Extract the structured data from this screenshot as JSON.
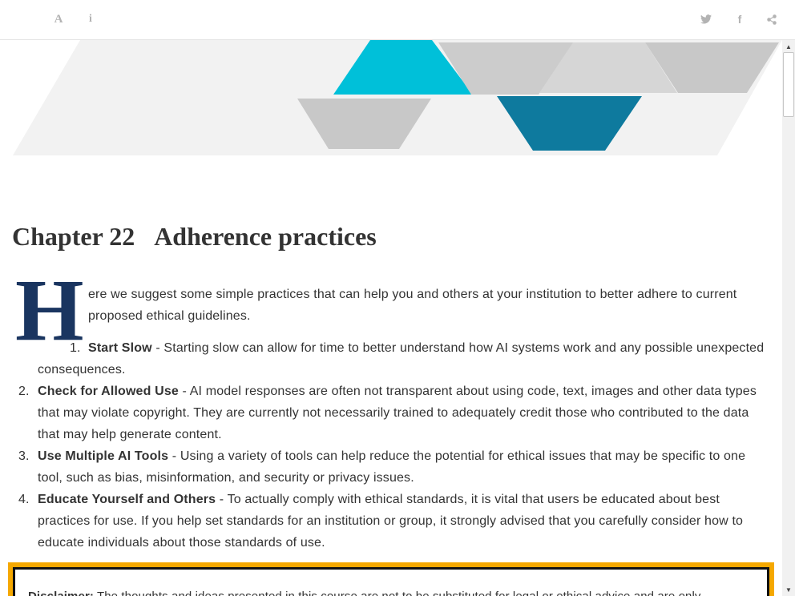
{
  "toolbar": {
    "font_icon_glyph": "A",
    "info_icon_glyph": "i",
    "twitter_icon_glyph": "",
    "facebook_icon_glyph": "f",
    "icon_color": "#b3b3b3"
  },
  "chapter": {
    "number": "Chapter 22",
    "title": "Adherence practices"
  },
  "intro": {
    "dropcap": "H",
    "text": "ere we suggest some simple practices that can help you and others at your institution to better adhere to current proposed ethical guidelines."
  },
  "practices": [
    {
      "num": "1.",
      "title": "Start Slow",
      "text": " - Starting slow can allow for time to better understand how AI systems work and any possible unexpected consequences."
    },
    {
      "num": "2.",
      "title": "Check for Allowed Use",
      "text": " - AI model responses are often not transparent about using code, text, images and other data types that may violate copyright. They are currently not necessarily trained to adequately credit those who contributed to the data that may help generate content."
    },
    {
      "num": "3.",
      "title": "Use Multiple AI Tools",
      "text": " - Using a variety of tools can help reduce the potential for ethical issues that may be specific to one tool, such as bias, misinformation, and security or privacy issues."
    },
    {
      "num": "4.",
      "title": "Educate Yourself and Others",
      "text": " - To actually comply with ethical standards, it is vital that users be educated about best practices for use. If you help set standards for an institution or group, it strongly advised that you carefully consider how to educate individuals about those standards of use."
    }
  ],
  "disclaimer": {
    "label": "Disclaimer:",
    "text": " The thoughts and ideas presented in this course are not to be substituted for legal or ethical advice and are only"
  },
  "colors": {
    "dropcap": "#1a3560",
    "banner_cyan": "#00c0d9",
    "banner_teal": "#0e7a9e",
    "banner_gray": "#cccccc",
    "disclaimer_border": "#f5a800"
  }
}
